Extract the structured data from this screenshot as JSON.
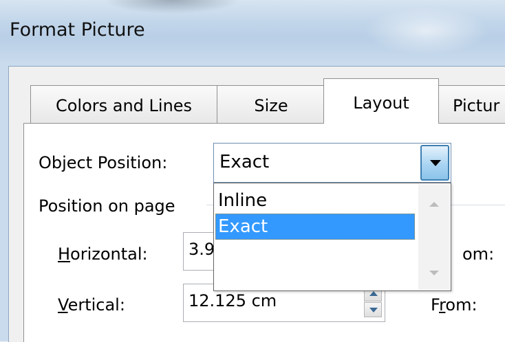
{
  "window": {
    "title": "Format Picture"
  },
  "tabs": [
    {
      "label": "Colors and Lines",
      "active": false
    },
    {
      "label": "Size",
      "active": false
    },
    {
      "label": "Layout",
      "active": true
    },
    {
      "label": "Pictur",
      "active": false
    }
  ],
  "layout": {
    "object_position_label": "Object Position:",
    "object_position_value": "Exact",
    "position_on_page_label": "Position on page",
    "horizontal_label_rest": "orizontal:",
    "horizontal_label_accel": "H",
    "horizontal_value": "3.9",
    "horizontal_from_label": "om:",
    "vertical_label_accel": "V",
    "vertical_label_rest": "ertical:",
    "vertical_value": "12.125 cm",
    "vertical_from_prefix": "F",
    "vertical_from_accel": "r",
    "vertical_from_rest": "om:"
  },
  "dropdown": {
    "options": [
      "Inline",
      "Exact"
    ],
    "selected": "Exact"
  },
  "colors": {
    "selection": "#3399ff",
    "title_bar": "#c2d6ea"
  }
}
